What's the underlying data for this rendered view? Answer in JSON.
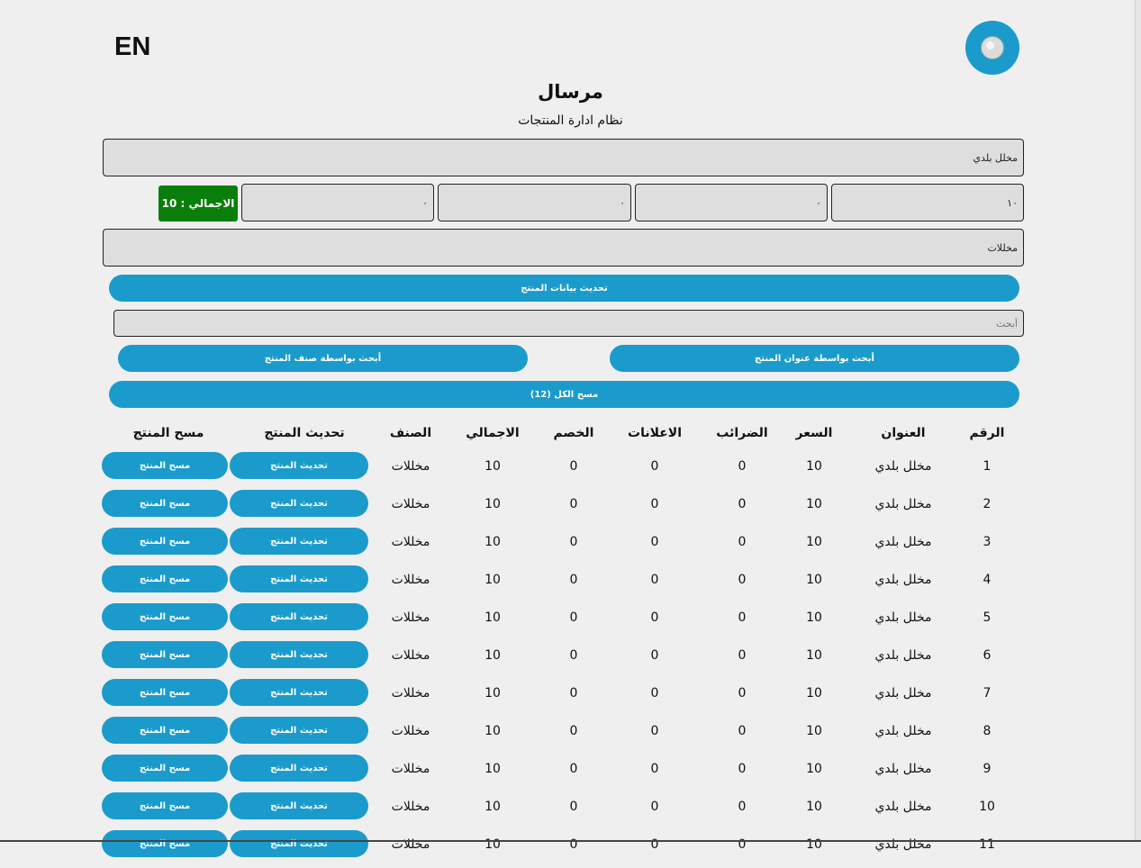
{
  "header": {
    "lang_toggle": "EN",
    "title": "مرسال",
    "subtitle": "نظام ادارة المنتجات"
  },
  "form": {
    "title_value": "مخلل بلدي",
    "price_value": "١٠",
    "taxes_value": "٠",
    "ads_value": "٠",
    "discount_value": "٠",
    "total_badge": "الاجمالي : 10",
    "category_value": "مخللات",
    "submit_label": "تحديث بيانات المنتج"
  },
  "search": {
    "placeholder": "أبحث",
    "by_title_label": "أبحث بواسطة عنوان المنتج",
    "by_category_label": "أبحث بواسطة صنف المنتج"
  },
  "delete_all_label": "مسح الكل (12)",
  "table": {
    "headers": {
      "id": "الرقم",
      "title": "العنوان",
      "price": "السعر",
      "taxes": "الضرائب",
      "ads": "الاعلانات",
      "discount": "الخصم",
      "total": "الاجمالي",
      "category": "الصنف",
      "update": "تحديث المنتج",
      "delete": "مسح المنتج"
    },
    "update_label": "تحديث المنتج",
    "delete_label": "مسح المنتج",
    "rows": [
      {
        "id": "1",
        "title": "مخلل بلدي",
        "price": "10",
        "taxes": "0",
        "ads": "0",
        "discount": "0",
        "total": "10",
        "category": "مخللات"
      },
      {
        "id": "2",
        "title": "مخلل بلدي",
        "price": "10",
        "taxes": "0",
        "ads": "0",
        "discount": "0",
        "total": "10",
        "category": "مخللات"
      },
      {
        "id": "3",
        "title": "مخلل بلدي",
        "price": "10",
        "taxes": "0",
        "ads": "0",
        "discount": "0",
        "total": "10",
        "category": "مخللات"
      },
      {
        "id": "4",
        "title": "مخلل بلدي",
        "price": "10",
        "taxes": "0",
        "ads": "0",
        "discount": "0",
        "total": "10",
        "category": "مخللات"
      },
      {
        "id": "5",
        "title": "مخلل بلدي",
        "price": "10",
        "taxes": "0",
        "ads": "0",
        "discount": "0",
        "total": "10",
        "category": "مخللات"
      },
      {
        "id": "6",
        "title": "مخلل بلدي",
        "price": "10",
        "taxes": "0",
        "ads": "0",
        "discount": "0",
        "total": "10",
        "category": "مخللات"
      },
      {
        "id": "7",
        "title": "مخلل بلدي",
        "price": "10",
        "taxes": "0",
        "ads": "0",
        "discount": "0",
        "total": "10",
        "category": "مخللات"
      },
      {
        "id": "8",
        "title": "مخلل بلدي",
        "price": "10",
        "taxes": "0",
        "ads": "0",
        "discount": "0",
        "total": "10",
        "category": "مخللات"
      },
      {
        "id": "9",
        "title": "مخلل بلدي",
        "price": "10",
        "taxes": "0",
        "ads": "0",
        "discount": "0",
        "total": "10",
        "category": "مخللات"
      },
      {
        "id": "10",
        "title": "مخلل بلدي",
        "price": "10",
        "taxes": "0",
        "ads": "0",
        "discount": "0",
        "total": "10",
        "category": "مخللات"
      },
      {
        "id": "11",
        "title": "مخلل بلدي",
        "price": "10",
        "taxes": "0",
        "ads": "0",
        "discount": "0",
        "total": "10",
        "category": "مخللات"
      }
    ]
  },
  "colors": {
    "accent": "#1b9bcc",
    "total_badge": "#0a7e0a",
    "field_bg": "#dedede",
    "page_bg": "#efefef"
  }
}
